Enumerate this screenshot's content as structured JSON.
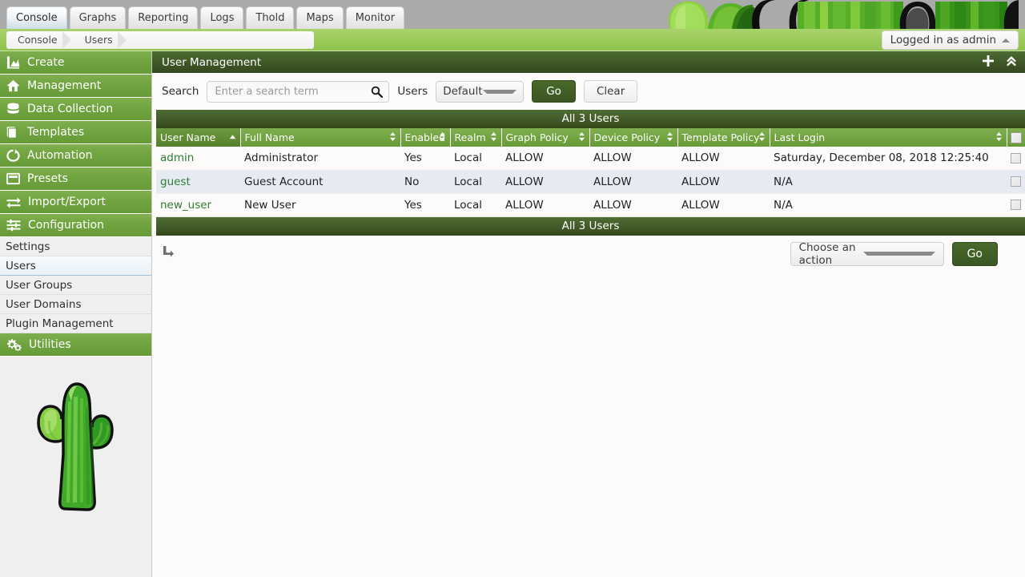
{
  "tabs": [
    {
      "label": "Console",
      "active": true
    },
    {
      "label": "Graphs",
      "active": false
    },
    {
      "label": "Reporting",
      "active": false
    },
    {
      "label": "Logs",
      "active": false
    },
    {
      "label": "Thold",
      "active": false
    },
    {
      "label": "Maps",
      "active": false
    },
    {
      "label": "Monitor",
      "active": false
    }
  ],
  "breadcrumb": {
    "items": [
      "Console",
      "Users"
    ]
  },
  "account": {
    "label": "Logged in as admin"
  },
  "sidebar": {
    "main_items": [
      {
        "label": "Create",
        "icon": "create-icon"
      },
      {
        "label": "Management",
        "icon": "home-icon"
      },
      {
        "label": "Data Collection",
        "icon": "database-icon"
      },
      {
        "label": "Templates",
        "icon": "templates-icon"
      },
      {
        "label": "Automation",
        "icon": "automation-icon"
      },
      {
        "label": "Presets",
        "icon": "presets-icon"
      },
      {
        "label": "Import/Export",
        "icon": "import-export-icon"
      },
      {
        "label": "Configuration",
        "icon": "sliders-icon"
      }
    ],
    "sub_items": [
      {
        "label": "Settings",
        "selected": false
      },
      {
        "label": "Users",
        "selected": true
      },
      {
        "label": "User Groups",
        "selected": false
      },
      {
        "label": "User Domains",
        "selected": false
      },
      {
        "label": "Plugin Management",
        "selected": false
      }
    ],
    "utilities": {
      "label": "Utilities",
      "icon": "gears-icon"
    }
  },
  "panel": {
    "title": "User Management",
    "add_icon": "plus-icon",
    "collapse_icon": "double-chevron-up-icon"
  },
  "search": {
    "label": "Search",
    "placeholder": "Enter a search term",
    "value": "",
    "icon": "search-icon",
    "filter_label": "Users",
    "filter_value": "Default",
    "go_label": "Go",
    "clear_label": "Clear"
  },
  "table": {
    "count_top": "All 3 Users",
    "count_bottom": "All 3 Users",
    "columns": [
      {
        "label": "User Name",
        "sort": "asc"
      },
      {
        "label": "Full Name",
        "sort": "none"
      },
      {
        "label": "Enabled",
        "sort": "none"
      },
      {
        "label": "Realm",
        "sort": "none"
      },
      {
        "label": "Graph Policy",
        "sort": "none"
      },
      {
        "label": "Device Policy",
        "sort": "none"
      },
      {
        "label": "Template Policy",
        "sort": "none"
      },
      {
        "label": "Last Login",
        "sort": "none"
      }
    ],
    "rows": [
      {
        "user_name": "admin",
        "full_name": "Administrator",
        "enabled": "Yes",
        "realm": "Local",
        "graph_policy": "ALLOW",
        "device_policy": "ALLOW",
        "template_policy": "ALLOW",
        "last_login": "Saturday, December 08, 2018 12:25:40"
      },
      {
        "user_name": "guest",
        "full_name": "Guest Account",
        "enabled": "No",
        "realm": "Local",
        "graph_policy": "ALLOW",
        "device_policy": "ALLOW",
        "template_policy": "ALLOW",
        "last_login": "N/A"
      },
      {
        "user_name": "new_user",
        "full_name": "New User",
        "enabled": "Yes",
        "realm": "Local",
        "graph_policy": "ALLOW",
        "device_policy": "ALLOW",
        "template_policy": "ALLOW",
        "last_login": "N/A"
      }
    ]
  },
  "footer_actions": {
    "sub_icon": "subaction-arrow-icon",
    "action_value": "Choose an action",
    "go_label": "Go"
  },
  "colors": {
    "accent_green": "#6fa33f",
    "dark_green": "#3d5526",
    "link_green": "#2e7d32",
    "crumb_bar": "#9ccb5c",
    "topbar_gray": "#aaaaaa",
    "row_alt": "#e6eaf2",
    "content_bg": "#fdfafa"
  }
}
